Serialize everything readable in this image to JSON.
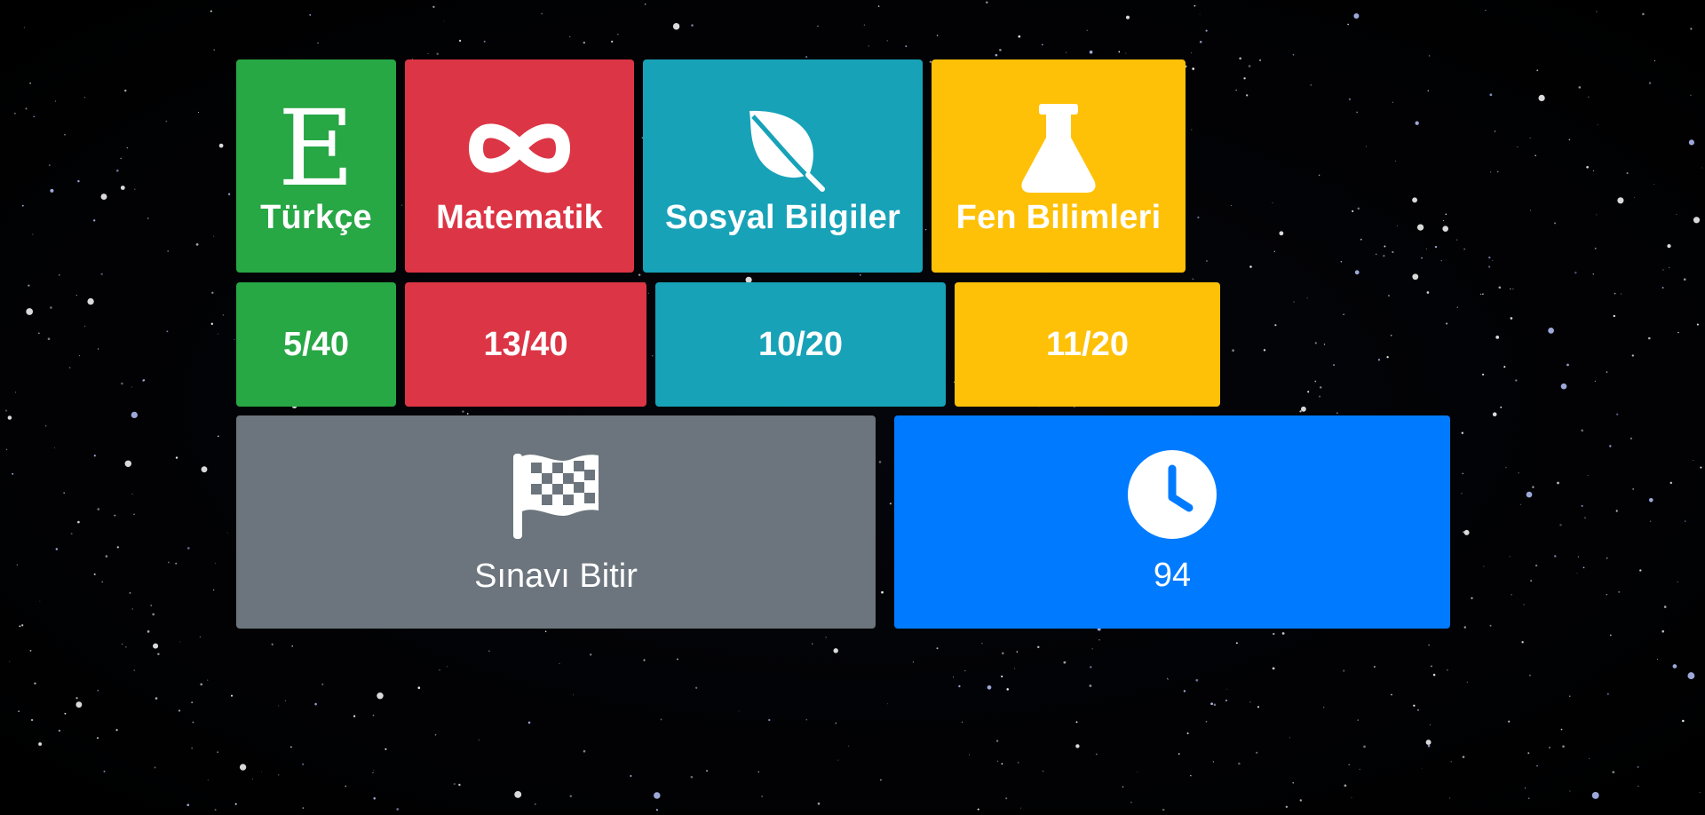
{
  "subjects": [
    {
      "label": "Türkçe",
      "icon": "letter-e-icon",
      "color": "#28a745",
      "score": "5/40"
    },
    {
      "label": "Matematik",
      "icon": "infinity-icon",
      "color": "#dc3545",
      "score": "13/40"
    },
    {
      "label": "Sosyal Bilgiler",
      "icon": "leaf-icon",
      "color": "#17a2b8",
      "score": "10/20"
    },
    {
      "label": "Fen Bilimleri",
      "icon": "flask-icon",
      "color": "#ffc107",
      "score": "11/20"
    }
  ],
  "icon_glyphs": {
    "turkce": "E"
  },
  "finish": {
    "label": "Sınavı Bitir",
    "icon": "checkered-flag-icon",
    "color": "#6c757d"
  },
  "timer": {
    "value": "94",
    "icon": "clock-icon",
    "color": "#007bff"
  }
}
